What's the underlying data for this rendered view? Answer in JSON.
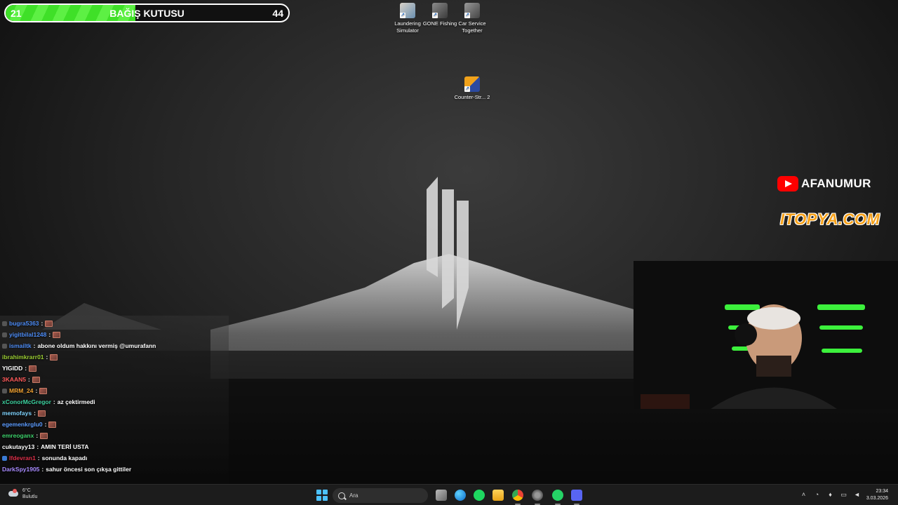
{
  "donation": {
    "start": "21",
    "title": "BAĞIŞ KUTUSU",
    "goal": "44",
    "progress_fraction": 0.46,
    "fill_color": "#3fe028"
  },
  "desktop_icons": [
    {
      "label": "Laundering Simulator",
      "icon": "laundering-simulator-icon"
    },
    {
      "label": "GONE Fishing",
      "icon": "gone-fishing-icon"
    },
    {
      "label": "Car Service Together",
      "icon": "car-service-together-icon"
    },
    {
      "label": "Counter-Str... 2",
      "icon": "counter-strike-2-icon"
    }
  ],
  "overlays": {
    "youtube_handle": "AFANUMUR",
    "sponsor": "ITOPYA.COM"
  },
  "chat": [
    {
      "user": "bugra5363",
      "color": "#4c8bf5",
      "message": "",
      "emote": true
    },
    {
      "user": "yigitbilal1248",
      "color": "#4c8bf5",
      "message": "",
      "emote": true
    },
    {
      "user": "ismailtk",
      "color": "#4c8bf5",
      "message": "abone oldum hakkını vermiş @umurafann",
      "emote": false
    },
    {
      "user": "ibrahimkrarr01",
      "color": "#9acd32",
      "message": "",
      "emote": true
    },
    {
      "user": "YIGIDD",
      "color": "#ffffff",
      "message": "",
      "emote": true
    },
    {
      "user": "3KAAN5",
      "color": "#ff5a5a",
      "message": "",
      "emote": true
    },
    {
      "user": "MRM_24",
      "color": "#f0a030",
      "message": "",
      "emote": true
    },
    {
      "user": "xConorMcGregor",
      "color": "#3cd3a0",
      "message": "az çektirmedi",
      "emote": false
    },
    {
      "user": "memofays",
      "color": "#7fd3ff",
      "message": "",
      "emote": true
    },
    {
      "user": "egemenkrglu0",
      "color": "#5c9cff",
      "message": "",
      "emote": true
    },
    {
      "user": "emreoganx",
      "color": "#3ccf6a",
      "message": "",
      "emote": true
    },
    {
      "user": "cukutayy13",
      "color": "#ffffff",
      "message": "AMIN TERİ USTA",
      "emote": false
    },
    {
      "user": "lfdevran1",
      "color": "#e0304a",
      "message": "sonunda kapadı",
      "emote": false
    },
    {
      "user": "DarkSpy1905",
      "color": "#a98cff",
      "message": "sahur öncesi son çıkşa gittiler",
      "emote": false
    }
  ],
  "taskbar": {
    "weather_temp": "6°C",
    "weather_desc": "Bulutlu",
    "search_placeholder": "Ara",
    "apps": [
      "task-view-icon",
      "edge-icon",
      "spotify-icon",
      "file-explorer-icon",
      "chrome-icon",
      "app-icon",
      "whatsapp-icon",
      "discord-icon"
    ],
    "clock_time": "23:34",
    "clock_date": "3.03.2026"
  }
}
